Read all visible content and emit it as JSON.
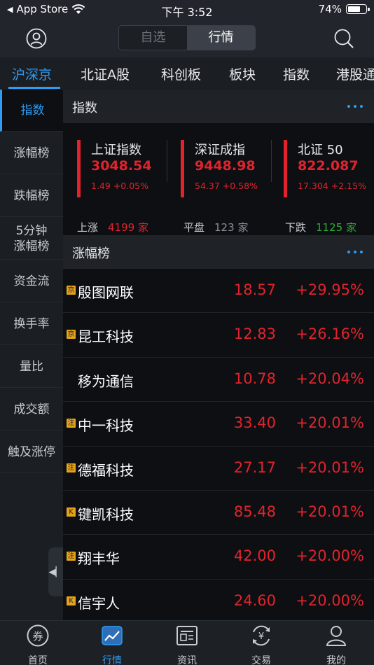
{
  "status_bar": {
    "back_label": "App Store",
    "time": "下午 3:52",
    "battery": "74%",
    "battery_level": 0.74
  },
  "header": {
    "segments": [
      {
        "label": "自选",
        "active": false
      },
      {
        "label": "行情",
        "active": true
      }
    ]
  },
  "market_tabs": [
    {
      "label": "沪深京",
      "active": true
    },
    {
      "label": "北证A股",
      "active": false
    },
    {
      "label": "科创板",
      "active": false
    },
    {
      "label": "板块",
      "active": false
    },
    {
      "label": "指数",
      "active": false
    },
    {
      "label": "港股通",
      "active": false
    }
  ],
  "sidebar": {
    "items": [
      {
        "label": "指数",
        "active": true
      },
      {
        "label": "涨幅榜",
        "active": false
      },
      {
        "label": "跌幅榜",
        "active": false
      },
      {
        "label": "5分钟\n涨幅榜",
        "active": false
      },
      {
        "label": "资金流",
        "active": false
      },
      {
        "label": "换手率",
        "active": false
      },
      {
        "label": "量比",
        "active": false
      },
      {
        "label": "成交额",
        "active": false
      },
      {
        "label": "触及涨停",
        "active": false
      }
    ]
  },
  "index_section": {
    "title": "指数",
    "cards": [
      {
        "name": "上证指数",
        "value": "3048.54",
        "change": "1.49",
        "pct": "+0.05%"
      },
      {
        "name": "深证成指",
        "value": "9448.98",
        "change": "54.37",
        "pct": "+0.58%"
      },
      {
        "name": "北证 50",
        "value": "822.087",
        "change": "17.304",
        "pct": "+2.15%"
      }
    ],
    "breadth": {
      "up_label": "上涨",
      "up_count": "4199",
      "up_unit": "家",
      "flat_label": "平盘",
      "flat_count": "123",
      "flat_unit": "家",
      "down_label": "下跌",
      "down_count": "1125",
      "down_unit": "家"
    }
  },
  "gainers_section": {
    "title": "涨幅榜",
    "rows": [
      {
        "badge": "京",
        "name": "殷图网联",
        "price": "18.57",
        "change": "+29.95%"
      },
      {
        "badge": "京",
        "name": "昆工科技",
        "price": "12.83",
        "change": "+26.16%"
      },
      {
        "badge": "",
        "name": "移为通信",
        "price": "10.78",
        "change": "+20.04%"
      },
      {
        "badge": "注",
        "name": "中一科技",
        "price": "33.40",
        "change": "+20.01%"
      },
      {
        "badge": "注",
        "name": "德福科技",
        "price": "27.17",
        "change": "+20.01%"
      },
      {
        "badge": "K",
        "name": "键凯科技",
        "price": "85.48",
        "change": "+20.01%"
      },
      {
        "badge": "注",
        "name": "翔丰华",
        "price": "42.00",
        "change": "+20.00%"
      },
      {
        "badge": "K",
        "name": "信宇人",
        "price": "24.60",
        "change": "+20.00%"
      }
    ]
  },
  "bottom_nav": [
    {
      "label": "首页",
      "icon": "coupon-icon",
      "active": false
    },
    {
      "label": "行情",
      "icon": "chart-icon",
      "active": true
    },
    {
      "label": "资讯",
      "icon": "news-icon",
      "active": false
    },
    {
      "label": "交易",
      "icon": "yen-exchange-icon",
      "active": false
    },
    {
      "label": "我的",
      "icon": "user-icon",
      "active": false
    }
  ],
  "colors": {
    "accent": "#2f9bf1",
    "up": "#e2232c",
    "down": "#2fab37",
    "badge": "#e5a21b"
  }
}
